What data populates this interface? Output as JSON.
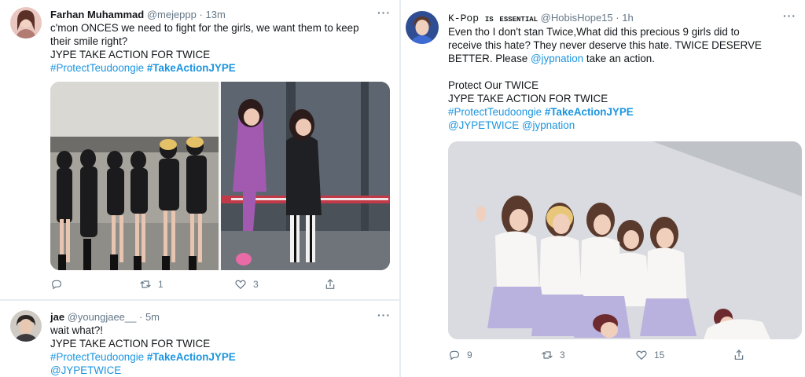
{
  "tweets": [
    {
      "name": "Farhan Muhammad",
      "handle": "@mejeppp",
      "time": "13m",
      "more": "···",
      "lines": [
        "c'mon ONCES we need to fight for the girls, we want them to keep",
        "their smile right?",
        "JYPE TAKE ACTION FOR TWICE"
      ],
      "hashtag1": "#ProtectTeudoongie",
      "hashtag2": "#TakeActionJYPE",
      "reply_count": "",
      "retweet_count": "1",
      "like_count": "3"
    },
    {
      "name": "jae",
      "handle": "@youngjaee__",
      "time": "5m",
      "more": "···",
      "lines": [
        "wait what?!",
        "JYPE TAKE ACTION FOR TWICE"
      ],
      "hashtag1": "#ProtectTeudoongie",
      "hashtag2": "#TakeActionJYPE",
      "mention1": "@JYPETWICE"
    },
    {
      "name_prefix": "K-Pop",
      "name_suffix": "is essential",
      "handle": "@HobisHope15",
      "time": "1h",
      "more": "···",
      "lines": [
        "Even tho I don't stan Twice,What did this precious 9 girls did to",
        "receive this hate? They never deserve this hate. TWICE DESERVE"
      ],
      "line3_pre": "BETTER. Please ",
      "line3_mention": "@jypnation",
      "line3_post": " take an action.",
      "line4": "Protect Our TWICE",
      "line5": "JYPE TAKE ACTION FOR TWICE",
      "hashtag1": "#ProtectTeudoongie",
      "hashtag2": "#TakeActionJYPE",
      "mention1": "@JYPETWICE",
      "mention2": "@jypnation",
      "reply_count": "9",
      "retweet_count": "3",
      "like_count": "15"
    }
  ],
  "icons": {
    "reply": "reply-icon",
    "retweet": "retweet-icon",
    "like": "heart-icon",
    "share": "share-icon"
  },
  "colors": {
    "link": "#1b95e0",
    "text": "#14171a",
    "muted": "#657786",
    "background": "#e6ecf0"
  }
}
